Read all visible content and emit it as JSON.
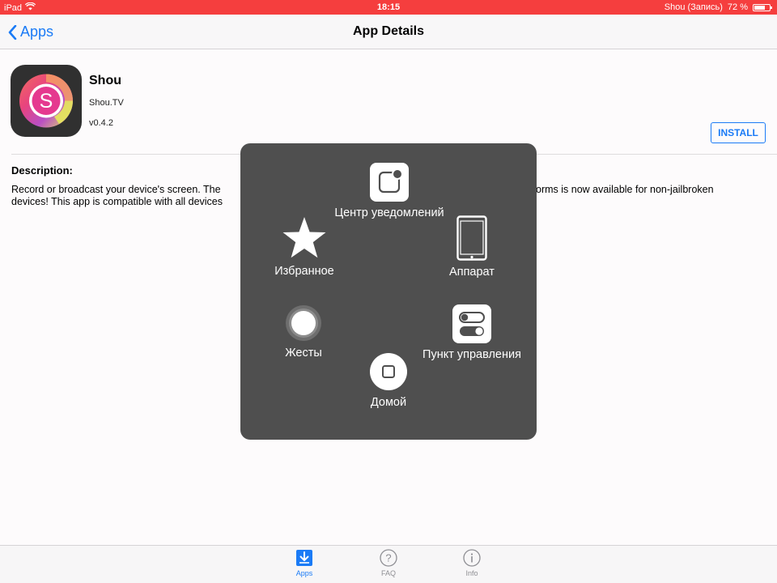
{
  "status_bar": {
    "device": "iPad",
    "time": "18:15",
    "recording": "Shou (Запись)",
    "battery_percent": "72 %",
    "battery_level": 0.72,
    "icons": [
      "wifi-icon",
      "battery-icon"
    ]
  },
  "nav": {
    "back_label": "Apps",
    "title": "App Details"
  },
  "app": {
    "name": "Shou",
    "developer": "Shou.TV",
    "version": "v0.4.2",
    "icon_letter": "S",
    "install_label": "INSTALL"
  },
  "description": {
    "heading": "Description:",
    "line1_start": "Record or broadcast your device's screen. The",
    "line1_end": "orms is now available for non-jailbroken",
    "line2_start": "devices! This app is compatible with all devices"
  },
  "assistive_touch": {
    "notification_center": "Центр уведомлений",
    "favorites": "Избранное",
    "device": "Аппарат",
    "gestures": "Жесты",
    "control_center": "Пункт управления",
    "home": "Домой"
  },
  "tabs": [
    {
      "label": "Apps",
      "icon": "download-icon",
      "active": true
    },
    {
      "label": "FAQ",
      "icon": "question-icon",
      "active": false
    },
    {
      "label": "Info",
      "icon": "info-icon",
      "active": false
    }
  ],
  "colors": {
    "status_bar": "#f53e3e",
    "accent": "#1b7bf6",
    "overlay": "#4f4f4f"
  }
}
